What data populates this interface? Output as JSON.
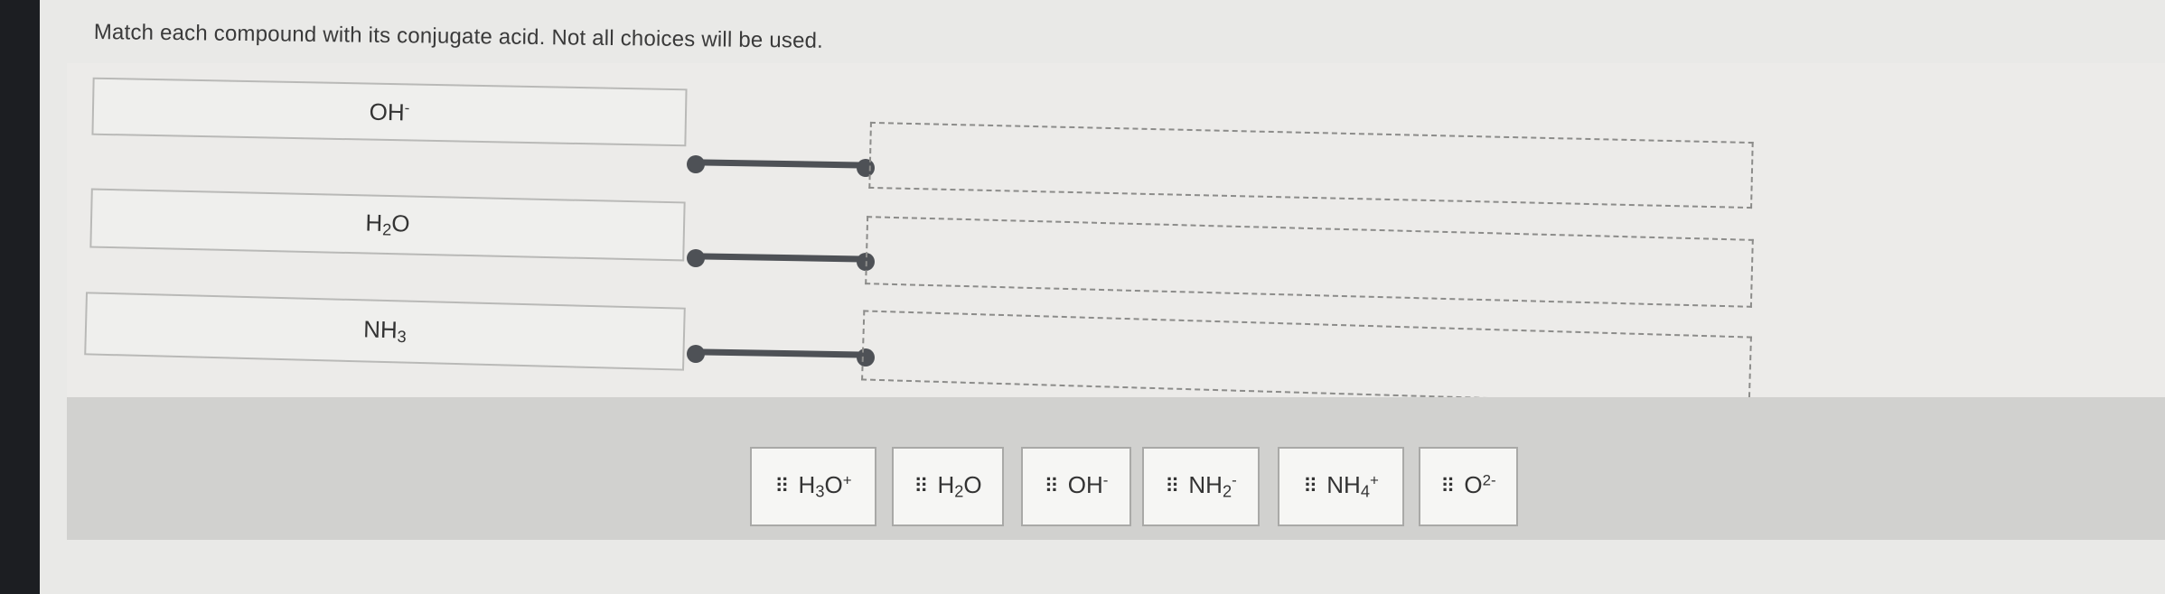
{
  "question": {
    "text": "Match each compound with its conjugate acid.  Not all choices will be used."
  },
  "prompts": [
    {
      "base": "OH",
      "sub": "",
      "sup": "-"
    },
    {
      "base": "H",
      "sub": "2",
      "tail": "O"
    },
    {
      "base": "NH",
      "sub": "3",
      "sup": ""
    }
  ],
  "choices": [
    {
      "grip_icon": "drag-handle-icon",
      "base": "H",
      "sub": "3",
      "tail": "O",
      "sup": "+"
    },
    {
      "grip_icon": "drag-handle-icon",
      "base": "H",
      "sub": "2",
      "tail": "O",
      "sup": ""
    },
    {
      "grip_icon": "drag-handle-icon",
      "base": "OH",
      "sub": "",
      "tail": "",
      "sup": "-"
    },
    {
      "grip_icon": "drag-handle-icon",
      "base": "NH",
      "sub": "2",
      "tail": "",
      "sup": "-"
    },
    {
      "grip_icon": "drag-handle-icon",
      "base": "NH",
      "sub": "4",
      "tail": "",
      "sup": "+"
    },
    {
      "grip_icon": "drag-handle-icon",
      "base": "O",
      "sub": "",
      "tail": "",
      "sup": "2-"
    }
  ],
  "colors": {
    "connector": "#4e5156",
    "tray": "#d1d1cf"
  }
}
